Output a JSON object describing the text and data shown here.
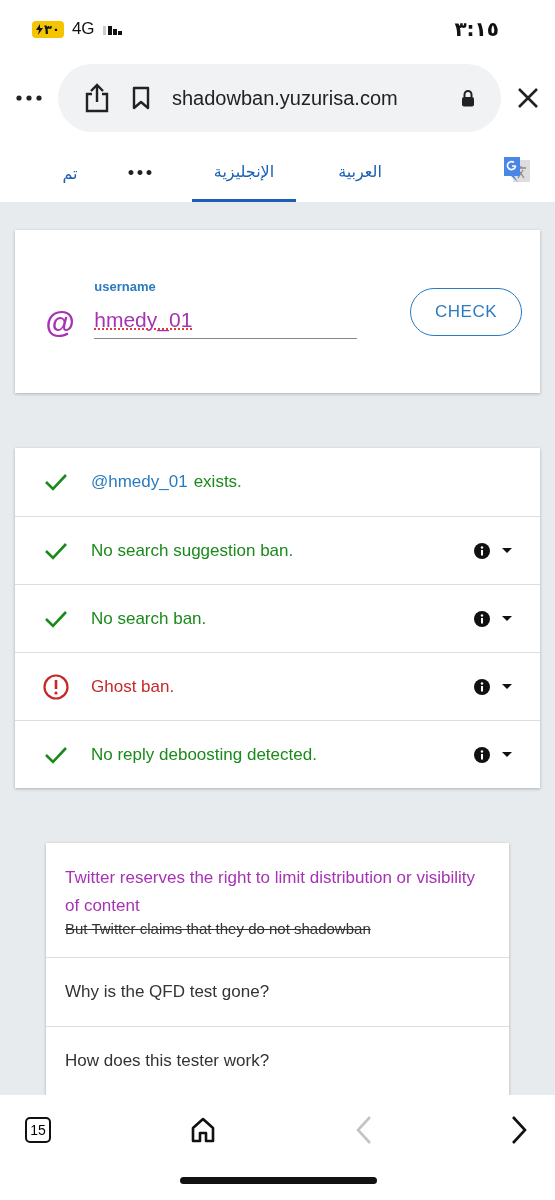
{
  "status_bar": {
    "battery": "٣٠",
    "network": "4G",
    "time": "٣:١٥"
  },
  "address_bar": {
    "url": "shadowban.yuzurisa.com"
  },
  "translate_bar": {
    "items": [
      {
        "label": "العربية",
        "kind": "tab",
        "selected": false
      },
      {
        "label": "الإنجليزية",
        "kind": "tab",
        "selected": true
      },
      {
        "label": "•••",
        "kind": "more"
      },
      {
        "label": "تم",
        "kind": "done"
      }
    ]
  },
  "search": {
    "label": "username",
    "prefix": "@",
    "value": "hmedy_01",
    "button": "CHECK"
  },
  "results": [
    {
      "kind": "pass",
      "handle": "@hmedy_01",
      "text": "exists.",
      "info": false
    },
    {
      "kind": "pass",
      "text": "No search suggestion ban.",
      "info": true
    },
    {
      "kind": "pass",
      "text": "No search ban.",
      "info": true
    },
    {
      "kind": "fail",
      "text": "Ghost ban.",
      "info": true
    },
    {
      "kind": "pass",
      "text": "No reply deboosting detected.",
      "info": true
    }
  ],
  "faq": [
    {
      "kind": "highlight",
      "title": "Twitter reserves the right to limit distribution or visibility of content",
      "subtitle": "But Twitter claims that they do not shadowban"
    },
    {
      "kind": "plain",
      "title": "Why is the QFD test gone?"
    },
    {
      "kind": "plain",
      "title": "How does this tester work?"
    }
  ],
  "toolbar": {
    "tab_count": "15",
    "back_disabled": true,
    "forward_disabled": false
  }
}
